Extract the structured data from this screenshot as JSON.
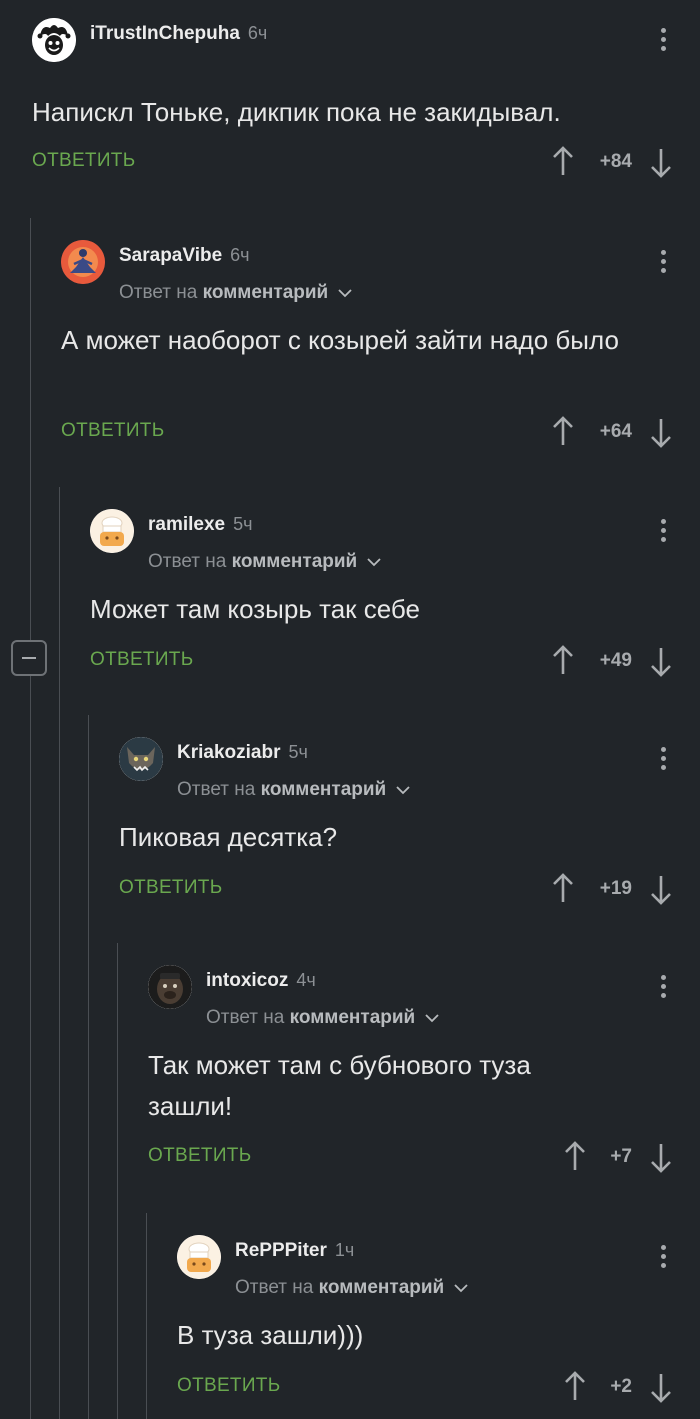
{
  "colors": {
    "background": "#212529",
    "reply": "#6aa84f",
    "muted": "#8c9094"
  },
  "comments": [
    {
      "username": "iTrustInChepuha",
      "time": "6ч",
      "reply_prefix": "",
      "reply_target": "",
      "text": "Напискл Тоньке, дикпик пока не закидывал.",
      "reply_label": "ОТВЕТИТЬ",
      "rating": "+84"
    },
    {
      "username": "SarapaVibe",
      "time": "6ч",
      "reply_prefix": "Ответ на",
      "reply_target": "комментарий",
      "text": "А может наоборот с козырей зайти надо было",
      "reply_label": "ОТВЕТИТЬ",
      "rating": "+64"
    },
    {
      "username": "ramilexe",
      "time": "5ч",
      "reply_prefix": "Ответ на",
      "reply_target": "комментарий",
      "text": "Может там козырь так себе",
      "reply_label": "ОТВЕТИТЬ",
      "rating": "+49"
    },
    {
      "username": "Kriakoziabr",
      "time": "5ч",
      "reply_prefix": "Ответ на",
      "reply_target": "комментарий",
      "text": "Пиковая десятка?",
      "reply_label": "ОТВЕТИТЬ",
      "rating": "+19"
    },
    {
      "username": "intoxicoz",
      "time": "4ч",
      "reply_prefix": "Ответ на",
      "reply_target": "комментарий",
      "text": "Так может там с бубнового туза зашли!",
      "reply_label": "ОТВЕТИТЬ",
      "rating": "+7"
    },
    {
      "username": "RePPPiter",
      "time": "1ч",
      "reply_prefix": "Ответ на",
      "reply_target": "комментарий",
      "text": "В туза зашли)))",
      "reply_label": "ОТВЕТИТЬ",
      "rating": "+2"
    }
  ]
}
